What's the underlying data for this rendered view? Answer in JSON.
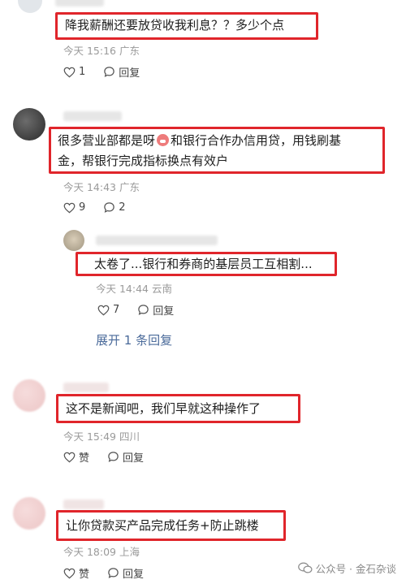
{
  "comments": [
    {
      "text": "降我薪酬还要放贷收我利息？？多少个点",
      "time": "今天 15:16",
      "location": "广东",
      "likes": "1",
      "reply_label": "回复"
    },
    {
      "text_line1_pre": "很多营业部都是呀",
      "text_line1_post": "和银行合作办信用贷，用钱刷基",
      "text_line2": "金，帮银行完成指标换点有效户",
      "time": "今天 14:43",
      "location": "广东",
      "likes": "9",
      "replies": "2",
      "emoji_name": "angry-face-emoji",
      "reply": {
        "text": "太卷了...银行和券商的基层员工互相割...",
        "time": "今天 14:44",
        "location": "云南",
        "likes": "7",
        "reply_label": "回复"
      },
      "expand_label": "展开 1 条回复"
    },
    {
      "text": "这不是新闻吧，我们早就这种操作了",
      "time": "今天 15:49",
      "location": "四川",
      "like_label": "赞",
      "reply_label": "回复"
    },
    {
      "text": "让你贷款买产品完成任务+防止跳楼",
      "time": "今天 18:09",
      "location": "上海",
      "like_label": "赞",
      "reply_label": "回复"
    }
  ],
  "watermark": "公众号 · 金石杂谈",
  "colors": {
    "highlight": "#e0252b",
    "link": "#4a6a9a",
    "meta": "#9a9a9a"
  }
}
